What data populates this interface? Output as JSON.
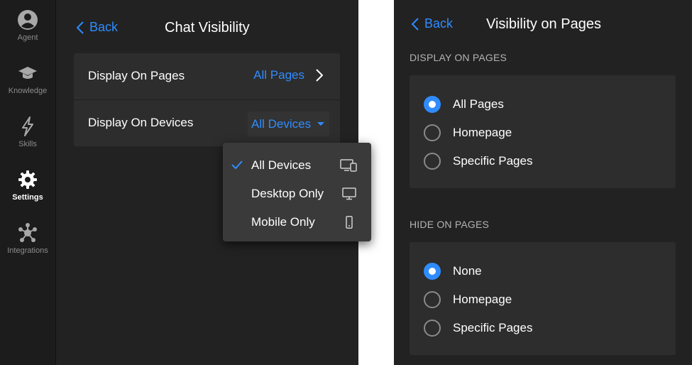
{
  "sidebar": {
    "items": [
      {
        "label": "Agent",
        "icon": "user-icon"
      },
      {
        "label": "Knowledge",
        "icon": "graduation-cap-icon"
      },
      {
        "label": "Skills",
        "icon": "lightning-icon"
      },
      {
        "label": "Settings",
        "icon": "gear-icon",
        "active": true
      },
      {
        "label": "Integrations",
        "icon": "network-icon"
      }
    ]
  },
  "chat_visibility": {
    "back_label": "Back",
    "title": "Chat Visibility",
    "rows": [
      {
        "label": "Display On Pages",
        "value": "All Pages"
      },
      {
        "label": "Display On Devices",
        "value": "All Devices"
      }
    ],
    "device_dropdown": {
      "options": [
        {
          "label": "All Devices",
          "icon": "desktop-mobile-icon",
          "selected": true
        },
        {
          "label": "Desktop Only",
          "icon": "monitor-icon",
          "selected": false
        },
        {
          "label": "Mobile Only",
          "icon": "phone-icon",
          "selected": false
        }
      ]
    }
  },
  "visibility_on_pages": {
    "back_label": "Back",
    "title": "Visibility on Pages",
    "display_section": {
      "heading": "DISPLAY ON PAGES",
      "options": [
        {
          "label": "All Pages",
          "selected": true
        },
        {
          "label": "Homepage",
          "selected": false
        },
        {
          "label": "Specific Pages",
          "selected": false
        }
      ]
    },
    "hide_section": {
      "heading": "HIDE ON PAGES",
      "options": [
        {
          "label": "None",
          "selected": true
        },
        {
          "label": "Homepage",
          "selected": false
        },
        {
          "label": "Specific Pages",
          "selected": false
        }
      ]
    }
  },
  "colors": {
    "accent": "#2f8cff",
    "background": "#222222",
    "sidebar": "#1c1c1c",
    "card": "#2d2d2d",
    "dropdown": "#3a3a3a"
  }
}
